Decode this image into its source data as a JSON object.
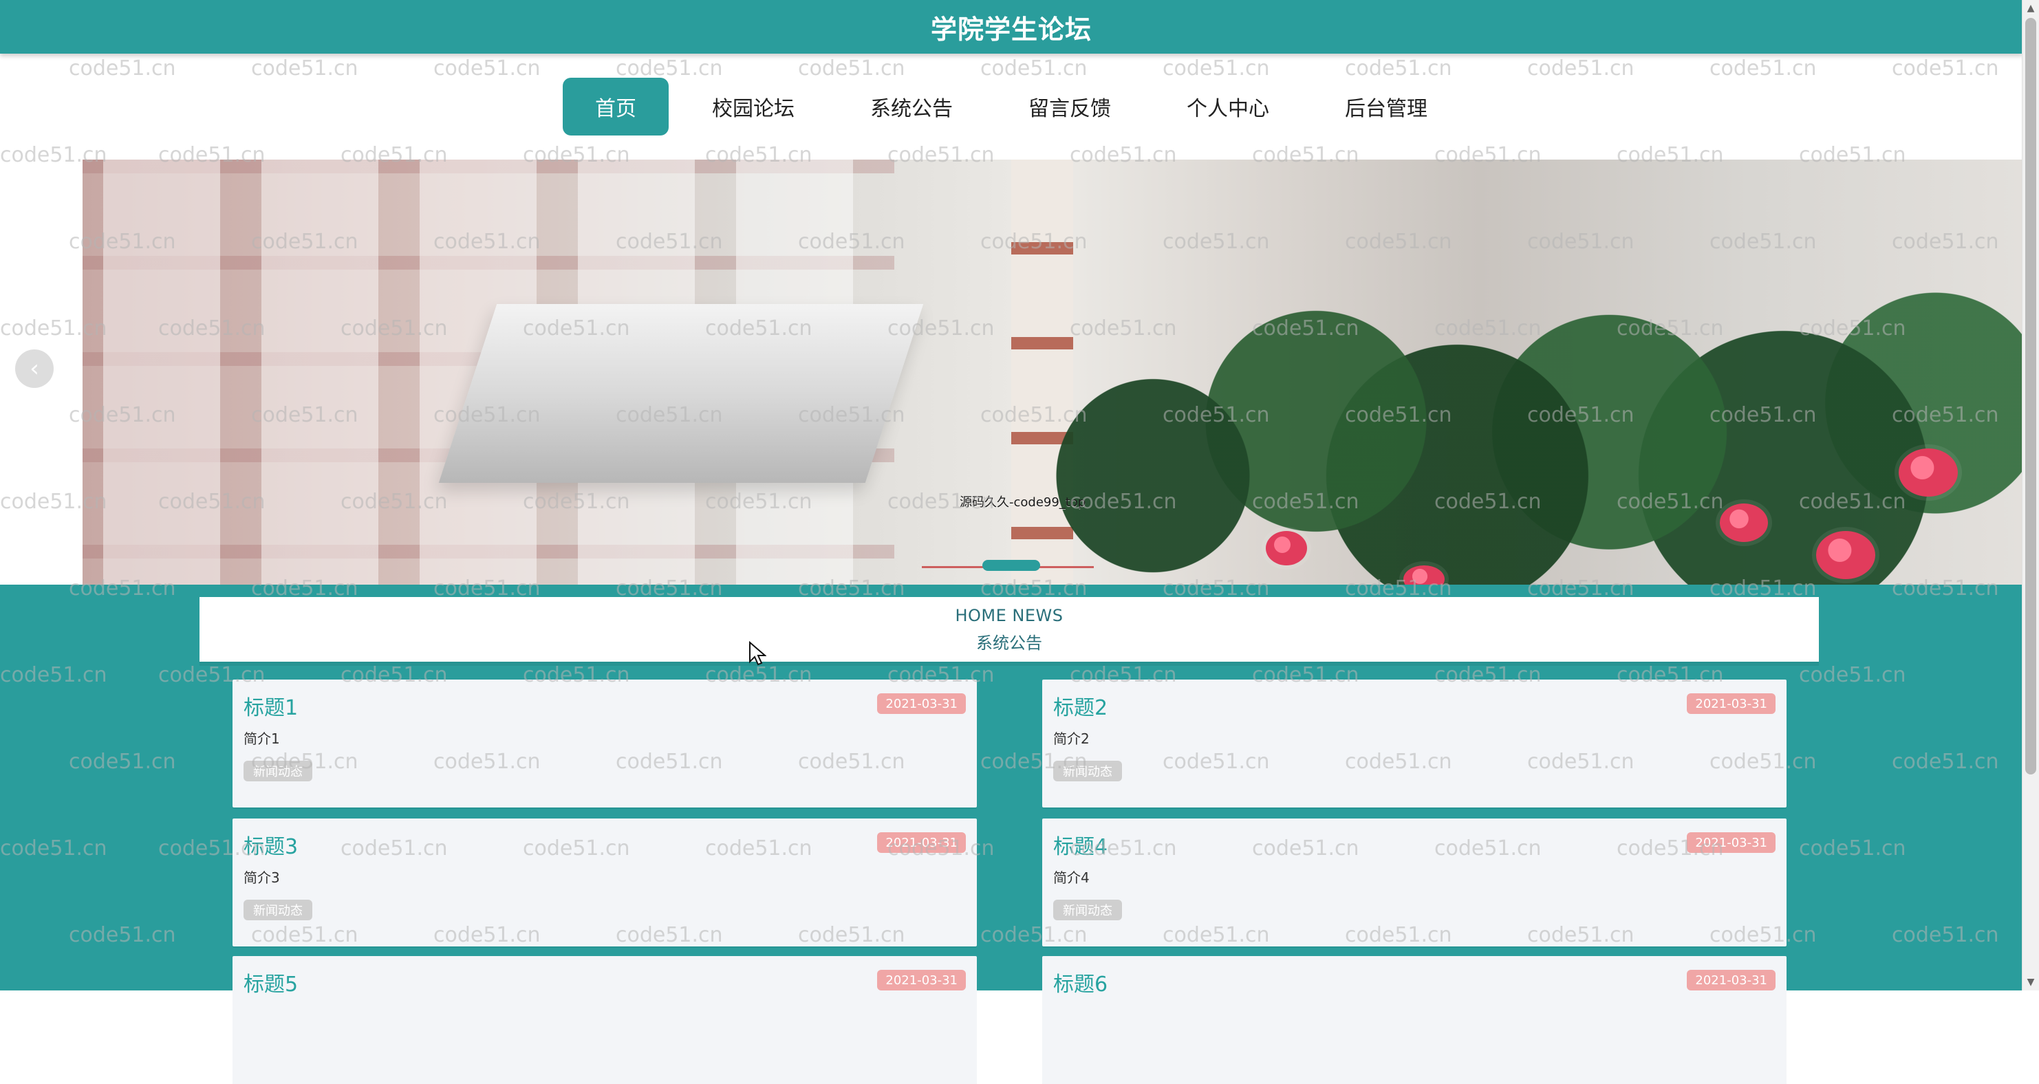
{
  "header": {
    "title": "学院学生论坛"
  },
  "nav": {
    "items": [
      {
        "label": "首页",
        "active": true
      },
      {
        "label": "校园论坛",
        "active": false
      },
      {
        "label": "系统公告",
        "active": false
      },
      {
        "label": "留言反馈",
        "active": false
      },
      {
        "label": "个人中心",
        "active": false
      },
      {
        "label": "后台管理",
        "active": false
      }
    ]
  },
  "carousel": {
    "caption": "源码久久-code99_top",
    "prev_icon": "chevron-left-icon"
  },
  "section": {
    "english_title": "HOME NEWS",
    "chinese_title": "系统公告"
  },
  "news": [
    {
      "title": "标题1",
      "date": "2021-03-31",
      "intro": "简介1",
      "tag": "新闻动态"
    },
    {
      "title": "标题2",
      "date": "2021-03-31",
      "intro": "简介2",
      "tag": "新闻动态"
    },
    {
      "title": "标题3",
      "date": "2021-03-31",
      "intro": "简介3",
      "tag": "新闻动态"
    },
    {
      "title": "标题4",
      "date": "2021-03-31",
      "intro": "简介4",
      "tag": "新闻动态"
    },
    {
      "title": "标题5",
      "date": "2021-03-31"
    },
    {
      "title": "标题6",
      "date": "2021-03-31"
    }
  ],
  "watermark": {
    "text": "code51.cn"
  },
  "colors": {
    "primary": "#2a9d9c",
    "date_badge": "#f0a6a6",
    "tag_badge": "#cfcfcf",
    "title_link": "#27a3a0"
  }
}
